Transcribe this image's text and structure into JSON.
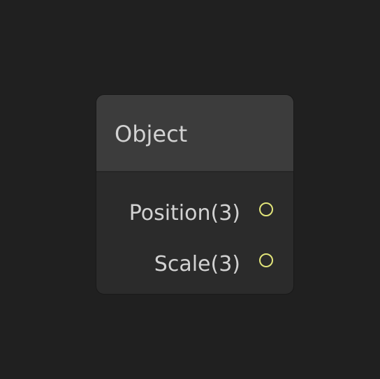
{
  "node": {
    "title": "Object",
    "ports": [
      {
        "label": "Position(3)",
        "type": "output"
      },
      {
        "label": "Scale(3)",
        "type": "output"
      }
    ]
  },
  "colors": {
    "canvas_background": "#202020",
    "node_body": "#2b2b2b",
    "node_header": "#3c3c3c",
    "text": "#d2d2d2",
    "port_outline": "#e2e57a"
  }
}
